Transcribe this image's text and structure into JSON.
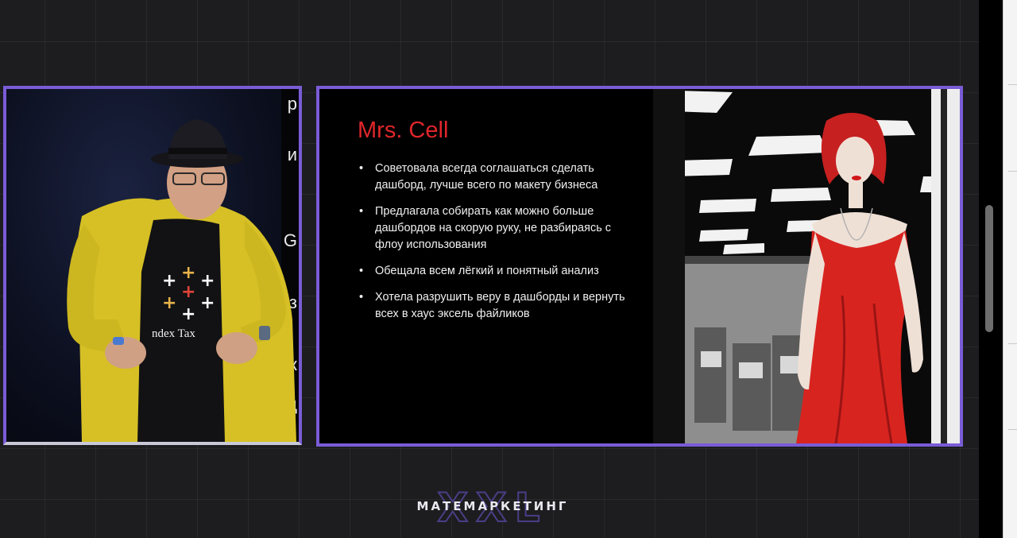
{
  "slide": {
    "title": "Mrs. Cell",
    "bullets": [
      "Советовала всегда соглашаться сделать дашборд, лучше всего по макету бизнеса",
      "Предлагала собирать как можно больше дашбордов на скорую руку, не разбираясь с флоу использования",
      "Обещала всем лёгкий и понятный анализ",
      "Хотела разрушить веру в дашборды и вернуть всех в хаус эксель файликов"
    ]
  },
  "speaker": {
    "shirt_text": "ndex Tax",
    "stage_letters": [
      "р",
      "и",
      "G",
      "з",
      "ж",
      "д"
    ]
  },
  "logo": {
    "big": "XXL",
    "text": "МАТЕМАРКЕТИНГ"
  },
  "colors": {
    "frame_border": "#7a5cd6",
    "title_red": "#e0262b",
    "jacket_yellow": "#d8c22a",
    "dress_red": "#d8241f"
  }
}
